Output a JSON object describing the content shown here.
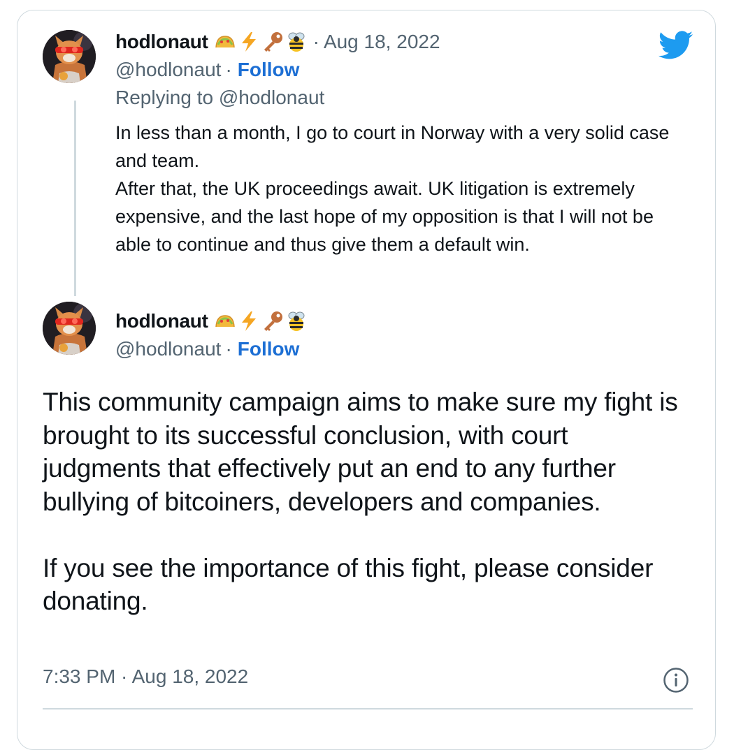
{
  "reply_tweet": {
    "display_name": "hodlonaut",
    "emojis": [
      "taco-icon",
      "lightning-icon",
      "key-icon",
      "bee-icon"
    ],
    "date": "Aug 18, 2022",
    "handle": "@hodlonaut",
    "follow_label": "Follow",
    "replying_to": "Replying to @hodlonaut",
    "text": "In less than a month, I go to court in Norway with a very solid case and team.\nAfter that, the UK proceedings await. UK litigation is extremely expensive, and the last hope of my opposition is that I will not be able to continue and thus give them a default win."
  },
  "main_tweet": {
    "display_name": "hodlonaut",
    "emojis": [
      "taco-icon",
      "lightning-icon",
      "key-icon",
      "bee-icon"
    ],
    "handle": "@hodlonaut",
    "follow_label": "Follow",
    "text": "This community campaign aims to make sure my fight is brought to its successful conclusion, with court judgments that effectively put an end to any further bullying of bitcoiners, developers and companies.\n\nIf you see the importance of this fight, please consider donating.",
    "timestamp": "7:33 PM · Aug 18, 2022"
  },
  "separator": "·",
  "colors": {
    "twitter_blue": "#1d9bf0",
    "follow_blue": "#1d6fd4",
    "secondary_text": "#536471",
    "border": "#cfd9de"
  },
  "icons": {
    "brand": "twitter-bird-icon",
    "info": "info-icon"
  }
}
